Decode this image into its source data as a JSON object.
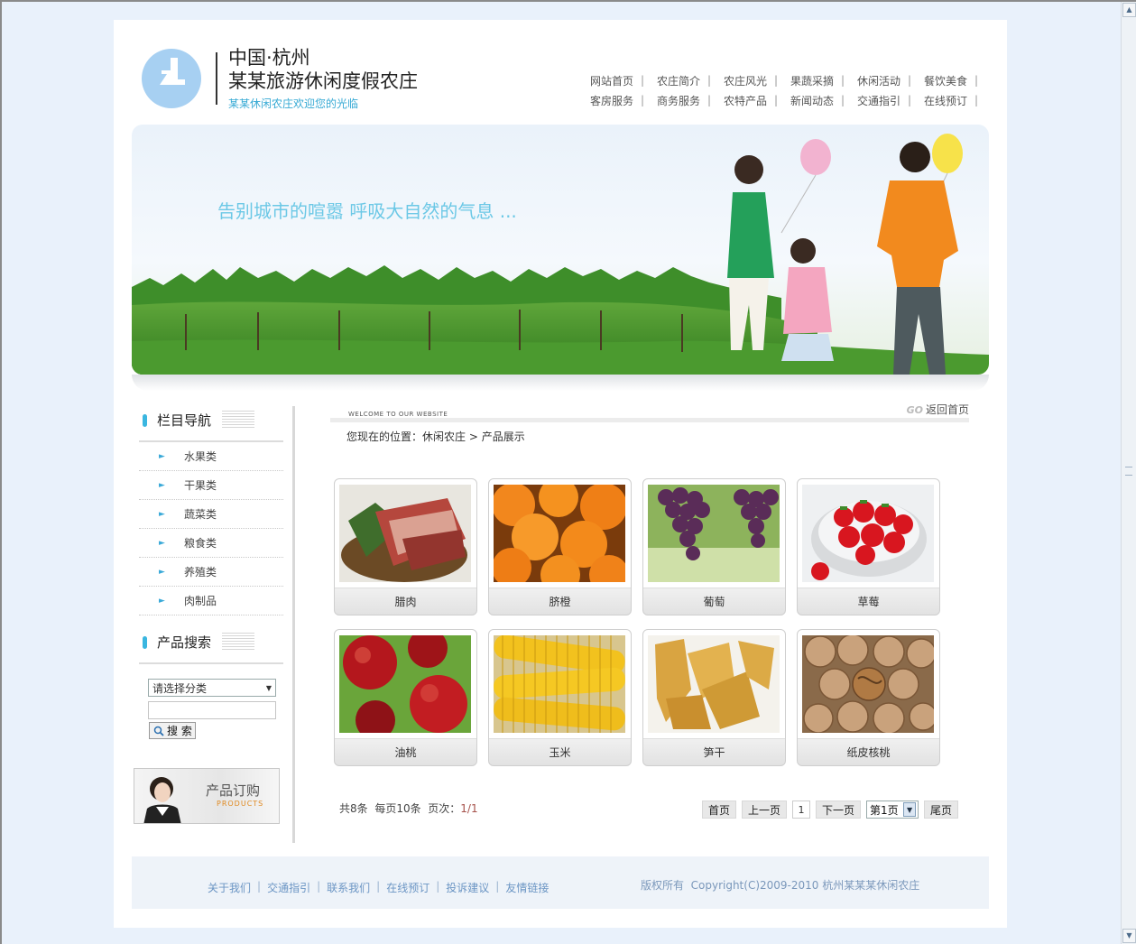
{
  "header": {
    "title_line1": "中国·杭州",
    "title_line2": "某某旅游休闲度假农庄",
    "subtitle": "某某休闲农庄欢迎您的光临"
  },
  "topnav": {
    "row1": [
      "网站首页",
      "农庄简介",
      "农庄风光",
      "果蔬采摘",
      "休闲活动",
      "餐饮美食"
    ],
    "row2": [
      "客房服务",
      "商务服务",
      "农特产品",
      "新闻动态",
      "交通指引",
      "在线预订"
    ],
    "separator": "|"
  },
  "banner": {
    "slogan": "告别城市的喧嚣 呼吸大自然的气息 ..."
  },
  "sidebar": {
    "nav_title": "栏目导航",
    "categories": [
      "水果类",
      "干果类",
      "蔬菜类",
      "粮食类",
      "养殖类",
      "肉制品"
    ],
    "search_title": "产品搜索",
    "select_value": "请选择分类",
    "search_input_value": "",
    "search_button": "搜 索",
    "order_banner_title": "产品订购",
    "order_banner_sub": "PRODUCTS"
  },
  "main": {
    "welcome_text": "WELCOME TO OUR WEBSITE",
    "go_label": "GO",
    "back_home": "返回首页",
    "breadcrumb_prefix": "您现在的位置：",
    "breadcrumb_home": "休闲农庄",
    "breadcrumb_sep": " > ",
    "breadcrumb_current": "产品展示",
    "products": [
      {
        "name": "腊肉",
        "image": "cured-meat"
      },
      {
        "name": "脐橙",
        "image": "navel-orange"
      },
      {
        "name": "葡萄",
        "image": "grapes"
      },
      {
        "name": "草莓",
        "image": "strawberry"
      },
      {
        "name": "油桃",
        "image": "nectarine"
      },
      {
        "name": "玉米",
        "image": "corn"
      },
      {
        "name": "笋干",
        "image": "dried-bamboo"
      },
      {
        "name": "纸皮核桃",
        "image": "walnut"
      }
    ]
  },
  "pager": {
    "total_label": "共",
    "total": "8",
    "total_unit": "条",
    "per_page_label": "每页",
    "per_page": "10",
    "per_page_unit": "条",
    "pages_label": "页次：",
    "pages": "1/1",
    "first": "首页",
    "prev": "上一页",
    "current": "1",
    "next": "下一页",
    "select_value": "第1页",
    "last": "尾页"
  },
  "footer": {
    "links": [
      "关于我们",
      "交通指引",
      "联系我们",
      "在线预订",
      "投诉建议",
      "友情链接"
    ],
    "link_sep": "|",
    "copyright": "版权所有  Copyright(C)2009-2010 杭州某某某休闲农庄"
  },
  "colors": {
    "accent": "#35a9d4",
    "footer_link": "#6b95c4",
    "page_bg": "#e9f1fb"
  }
}
